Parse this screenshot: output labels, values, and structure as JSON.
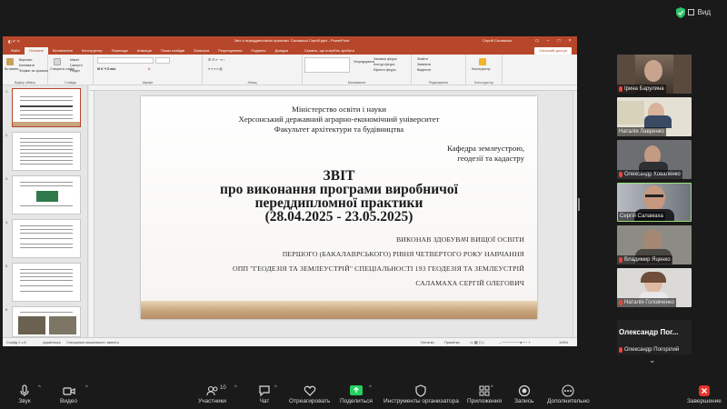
{
  "window": {
    "view_label": "Вид",
    "security_color": "#2ec26d"
  },
  "ppt": {
    "doc_title": "Звіт з переддипломної практики. Саламаха Сергій.pptx - PowerPoint",
    "user": "Сергій Саламаха",
    "tabs": [
      "Файл",
      "Основне",
      "Вставлення",
      "Конструктор",
      "Переходи",
      "Анімація",
      "Показ слайдів",
      "Записати",
      "Рецензування",
      "Подання",
      "Довідка"
    ],
    "search_placeholder": "Скажіть, що потрібно зробити",
    "accessibility_button": "Спільний доступ",
    "ribbon": {
      "clipboard": {
        "paste": "Вставити",
        "cut": "Вирізати",
        "copy": "Копіювати",
        "format": "Формат за зразком",
        "label": "Буфер обміну"
      },
      "slides": {
        "new": "Створити слайд",
        "layout": "Макет",
        "reset": "Скинути",
        "section": "Розділ",
        "label": "Слайди"
      },
      "font_label": "Шрифт",
      "paragraph_label": "Абзац",
      "drawing": {
        "arrange": "Упорядкувати",
        "quick_styles": "Експрес-стилі",
        "fill": "Заливка фігури",
        "outline": "Контур фігури",
        "effects": "Ефекти фігури",
        "label": "Малювання"
      },
      "editing": {
        "find": "Знайти",
        "replace": "Замінити",
        "select": "Виділити",
        "label": "Редагування"
      },
      "designer": {
        "ideas": "Конструктор",
        "label": "Конструктор"
      }
    },
    "thumbnails": [
      "1",
      "2",
      "3",
      "4",
      "5",
      "6"
    ],
    "notes_placeholder": "Нотатки до слайда",
    "status": {
      "slide": "Слайд 1 з 6",
      "lang": "українська",
      "accessibility": "Спеціальні можливості: вивчіть",
      "notes": "Нотатки",
      "comments": "Примітки",
      "zoom": "105%"
    }
  },
  "slide": {
    "line1": "Міністерство освіти і науки",
    "line2": "Херсонський державний аграрно-економічний університет",
    "line3": "Факультет архітектури та будівництва",
    "dept1": "Кафедра землеустрою,",
    "dept2": "геодезії та кадастру",
    "title1": "ЗВІТ",
    "title2": "про виконання програми виробничої",
    "title3": "переддипломної практики",
    "title4": "(28.04.2025 - 23.05.2025)",
    "caps1": "ВИКОНАВ ЗДОБУВАЧ ВИЩОЇ ОСВІТИ",
    "caps2": "ПЕРШОГО (БАКАЛАВРСЬКОГО) РІВНЯ ЧЕТВЕРТОГО РОКУ НАВЧАННЯ",
    "caps3": "ОПП \"ГЕОДЕЗІЯ ТА ЗЕМЛЕУСТРІЙ\" СПЕЦІАЛЬНОСТІ 193 ГЕОДЕЗІЯ ТА ЗЕМЛЕУСТРІЙ",
    "caps4": "САЛАМАХА СЕРГІЙ ОЛЕГОВИЧ"
  },
  "participants": [
    {
      "name": "Ірина Барулина"
    },
    {
      "name": "Наталія Лавренко"
    },
    {
      "name": "Олександр Коваленко"
    },
    {
      "name": "Сергій Саламаха"
    },
    {
      "name": "Владимир Яценко"
    },
    {
      "name": "Наталія Головченко"
    },
    {
      "name": "Олександр Погорілий"
    }
  ],
  "big_name": "Олександр Пог...",
  "toolbar": {
    "audio": "Звук",
    "video": "Видео",
    "participants": "Участники",
    "participants_count": "10",
    "chat": "Чат",
    "react": "Отреагировать",
    "share": "Поделиться",
    "host_tools": "Инструменты организатора",
    "apps": "Приложения",
    "record": "Запись",
    "more": "Дополнительно",
    "end": "Завершение"
  }
}
